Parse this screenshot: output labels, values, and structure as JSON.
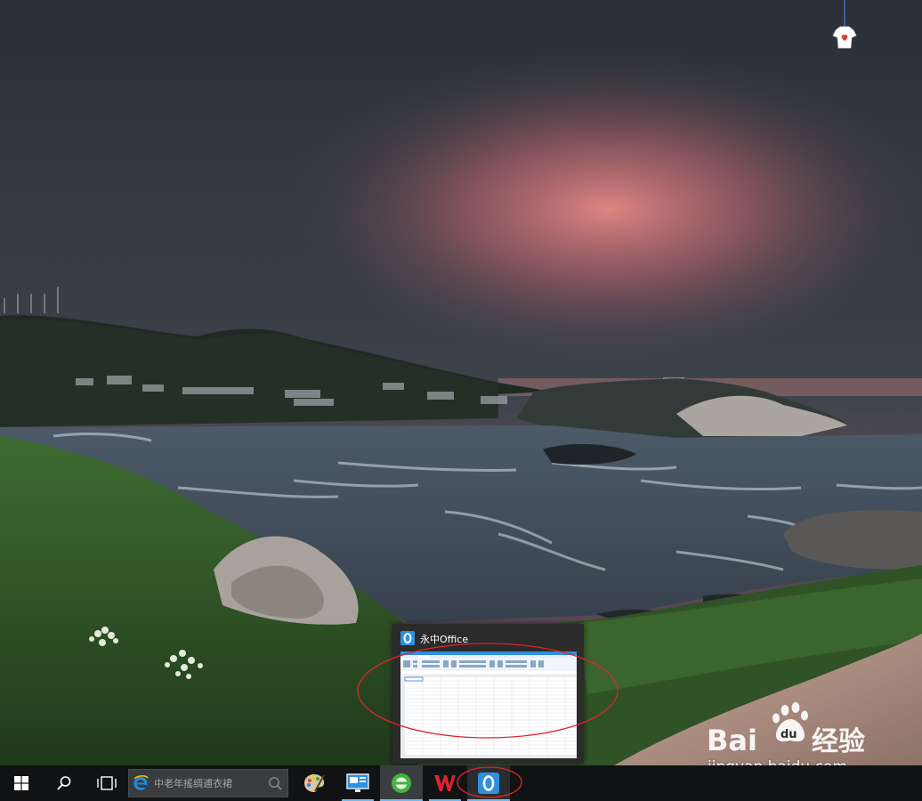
{
  "preview": {
    "title": "永中Office"
  },
  "taskbar": {
    "search_placeholder": "中老年搖绸逋衣裙",
    "items": [
      {
        "name": "start-button",
        "icon": "windows-logo-icon"
      },
      {
        "name": "cortana-search-button",
        "icon": "search-icon"
      },
      {
        "name": "task-view-button",
        "icon": "task-view-icon"
      },
      {
        "name": "taskbar-app-paint",
        "icon": "paint-palette-icon"
      },
      {
        "name": "taskbar-app-monitor",
        "icon": "monitor-icon"
      },
      {
        "name": "taskbar-app-browser-green",
        "icon": "green-browser-icon"
      },
      {
        "name": "taskbar-app-wps",
        "icon": "wps-icon"
      },
      {
        "name": "taskbar-app-yozo-office",
        "icon": "yozo-office-icon"
      }
    ]
  },
  "watermark": {
    "brand_latin": "Bai",
    "brand_du": "du",
    "brand_cn": "经验",
    "url": "jingyan.baidu.com"
  },
  "colors": {
    "taskbar": "#101214",
    "accent": "#76b9ed",
    "annotation": "#e0242a",
    "yozo_blue": "#2f8fe0",
    "wps_red": "#d9232e"
  }
}
